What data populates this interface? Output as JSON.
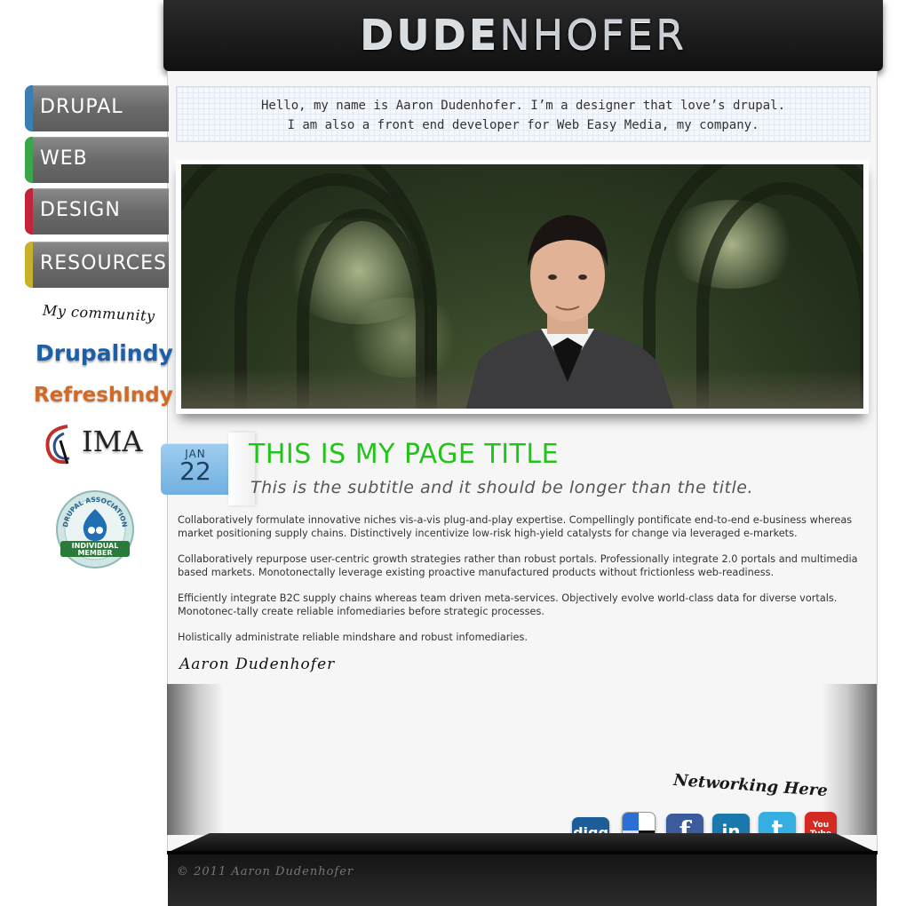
{
  "header": {
    "logo_part1": "DUDE",
    "logo_part2": "NHOFER"
  },
  "intro": {
    "line1": "Hello, my name is Aaron Dudenhofer. I’m a designer that love’s drupal.",
    "line2": "I am also a front end developer for Web Easy Media, my company."
  },
  "nav": {
    "items": [
      {
        "label": "DRUPAL",
        "accent": "#3a7fb4"
      },
      {
        "label": "WEB",
        "accent": "#3aa64a"
      },
      {
        "label": "DESIGN",
        "accent": "#c4243b"
      },
      {
        "label": "RESOURCES",
        "accent": "#c6b22a"
      }
    ]
  },
  "community": {
    "label": "My community",
    "drupalindy": "Drupalindy",
    "refreshindy": "RefreshIndy",
    "ima": "IMA",
    "badge_top": "DRUPAL ASSOCIATION",
    "badge_mid": "INDIVIDUAL",
    "badge_bot": "MEMBER"
  },
  "post": {
    "date_month": "JAN",
    "date_day": "22",
    "title": "THIS IS MY PAGE TITLE",
    "subtitle": "This is the subtitle and it should be longer than the title.",
    "paragraphs": [
      "Collaboratively formulate innovative niches vis-a-vis plug-and-play expertise. Compellingly pontificate end-to-end e-business whereas market positioning supply chains. Distinctively incentivize low-risk high-yield catalysts for change via leveraged e-markets.",
      "Collaboratively repurpose user-centric growth strategies rather than robust portals. Professionally integrate 2.0 portals and multimedia based markets. Monotonectally leverage existing proactive manufactured products without frictionless web-readiness.",
      "Efficiently integrate B2C supply chains whereas team driven meta-services. Objectively evolve world-class data for diverse vortals. Monotonec-tally create reliable infomediaries before strategic processes.",
      "Holistically administrate reliable mindshare and robust infomediaries."
    ],
    "signature": "Aaron Dudenhofer"
  },
  "networking": {
    "label": "Networking Here",
    "icons": [
      {
        "name": "digg-icon",
        "text": "digg",
        "color": "#1c5d97"
      },
      {
        "name": "delicious-icon",
        "text": "",
        "color": "#2a6fd6"
      },
      {
        "name": "facebook-icon",
        "text": "f",
        "color": "#3b5b9d"
      },
      {
        "name": "linkedin-icon",
        "text": "in",
        "color": "#1a78ad"
      },
      {
        "name": "twitter-icon",
        "text": "t",
        "color": "#35aee0"
      },
      {
        "name": "youtube-icon",
        "text": "You Tube",
        "color": "#d42a21"
      }
    ]
  },
  "footer": {
    "copyright": "© 2011 Aaron Dudenhofer"
  }
}
